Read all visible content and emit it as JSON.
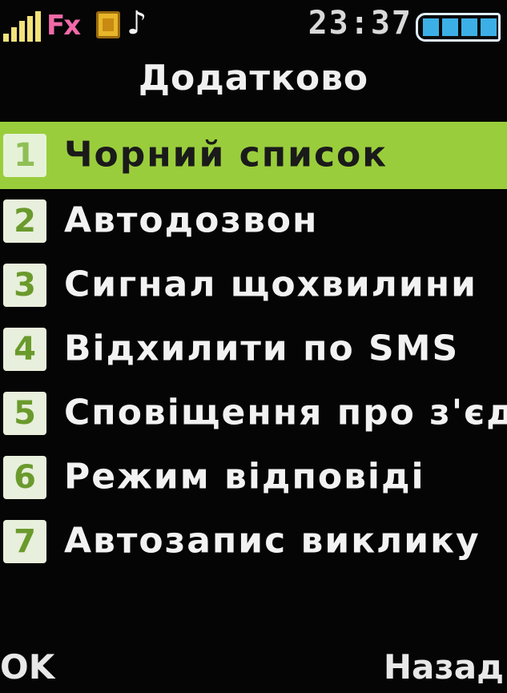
{
  "status_bar": {
    "time": "23:37",
    "signal_icon": "signal-strength-icon",
    "gprs_label": "Fx",
    "sim_icon": "sim-card-icon",
    "music_icon": "music-note-icon",
    "music_glyph": "♪",
    "battery_level": 1.0
  },
  "title": "Додатково",
  "menu": {
    "items": [
      {
        "number": "1",
        "label": "Чорний список",
        "selected": true
      },
      {
        "number": "2",
        "label": "Автодозвон",
        "selected": false
      },
      {
        "number": "3",
        "label": "Сигнал щохвилини",
        "selected": false
      },
      {
        "number": "4",
        "label": "Відхилити по SMS",
        "selected": false
      },
      {
        "number": "5",
        "label": "Сповіщення про з'єд...",
        "selected": false
      },
      {
        "number": "6",
        "label": "Режим відповіді",
        "selected": false
      },
      {
        "number": "7",
        "label": "Автозапис виклику",
        "selected": false
      }
    ]
  },
  "softkeys": {
    "left": "OK",
    "right": "Назад"
  },
  "colors": {
    "highlight": "#9acd3c",
    "background": "#050505",
    "text": "#f2f2f2",
    "badge": "#e8efdc",
    "badge_number": "#6a9a2c"
  }
}
